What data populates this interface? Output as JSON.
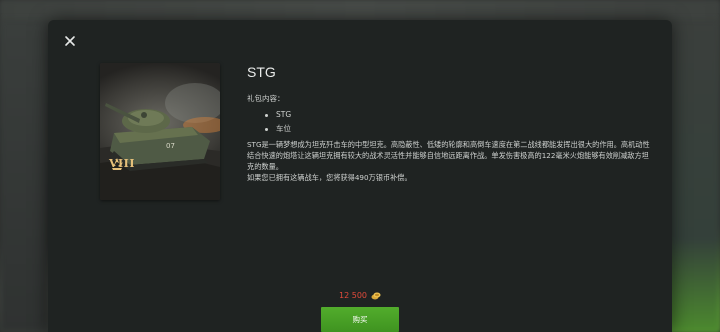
{
  "bundle": {
    "title": "STG",
    "contents_label": "礼包内容：",
    "items": [
      "STG",
      "车位"
    ],
    "description": "STG是一辆梦想成为坦克歼击车的中型坦克。高隐蔽性、低矮的轮廓和高倒车速度在第二战线都能发挥出很大的作用。高机动性结合快速的炮塔让这辆坦克拥有较大的战术灵活性并能够自信地远距离作战。单发伤害极高的122毫米火炮能够有效削减敌方坦克的数量。",
    "compensation_note": "如果您已拥有这辆战车，您将获得490万银币补偿。",
    "tier": "VIII",
    "price": "12 500",
    "currency_icon": "gold-coins-icon",
    "buy_label": "购买"
  },
  "colors": {
    "buy_button": "#4aa126",
    "price_text": "#e24b3b",
    "tier_gold": "#e6c07a",
    "dialog_bg": "#1f2322"
  }
}
